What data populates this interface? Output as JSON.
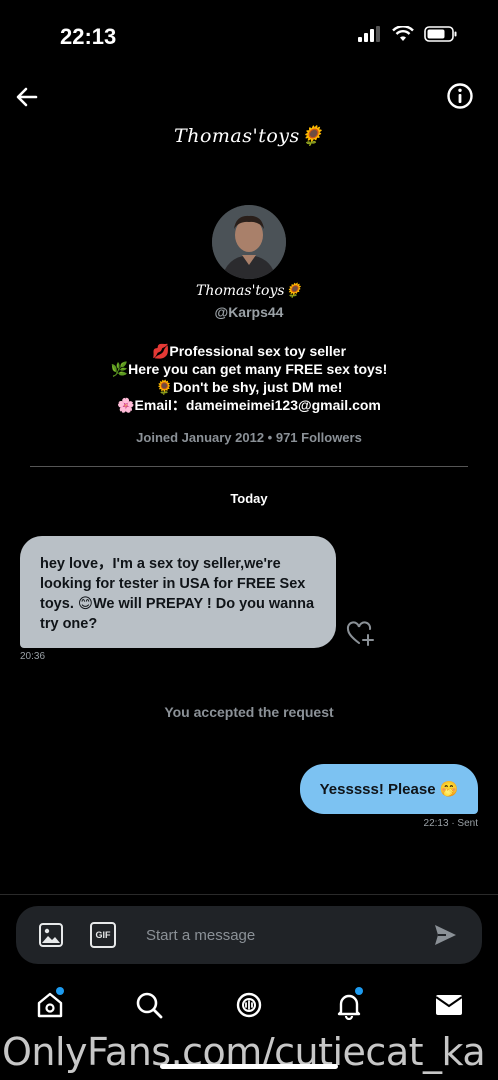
{
  "status_bar": {
    "time": "22:13"
  },
  "header": {
    "title": "Thomas'toys🌻"
  },
  "profile": {
    "name": "Thomas'toys🌻",
    "handle": "@Karps44",
    "bio": [
      "💋Professional sex toy seller",
      "🌿Here you can get many FREE sex toys!",
      "🌻Don't be shy, just DM me!",
      "🌸Email：dameimeimei123@gmail.com"
    ],
    "joined": "Joined January 2012 • 971 Followers"
  },
  "conversation": {
    "day_label": "Today",
    "incoming": {
      "text": "hey love，I'm a sex toy seller,we're looking for tester in USA for FREE Sex toys. 😊We will PREPAY ! Do you wanna try one?",
      "time": "20:36"
    },
    "system_note": "You accepted the request",
    "outgoing": {
      "text": "Yesssss! Please 🤭",
      "time": "22:13 · Sent"
    }
  },
  "composer": {
    "placeholder": "Start a message",
    "gif_label": "GIF"
  },
  "watermark": "OnlyFans.com/cutiecat_ka",
  "colors": {
    "accent": "#1d9bf0",
    "incoming_bubble": "#b9c0c6",
    "outgoing_bubble": "#7cc2f2"
  }
}
